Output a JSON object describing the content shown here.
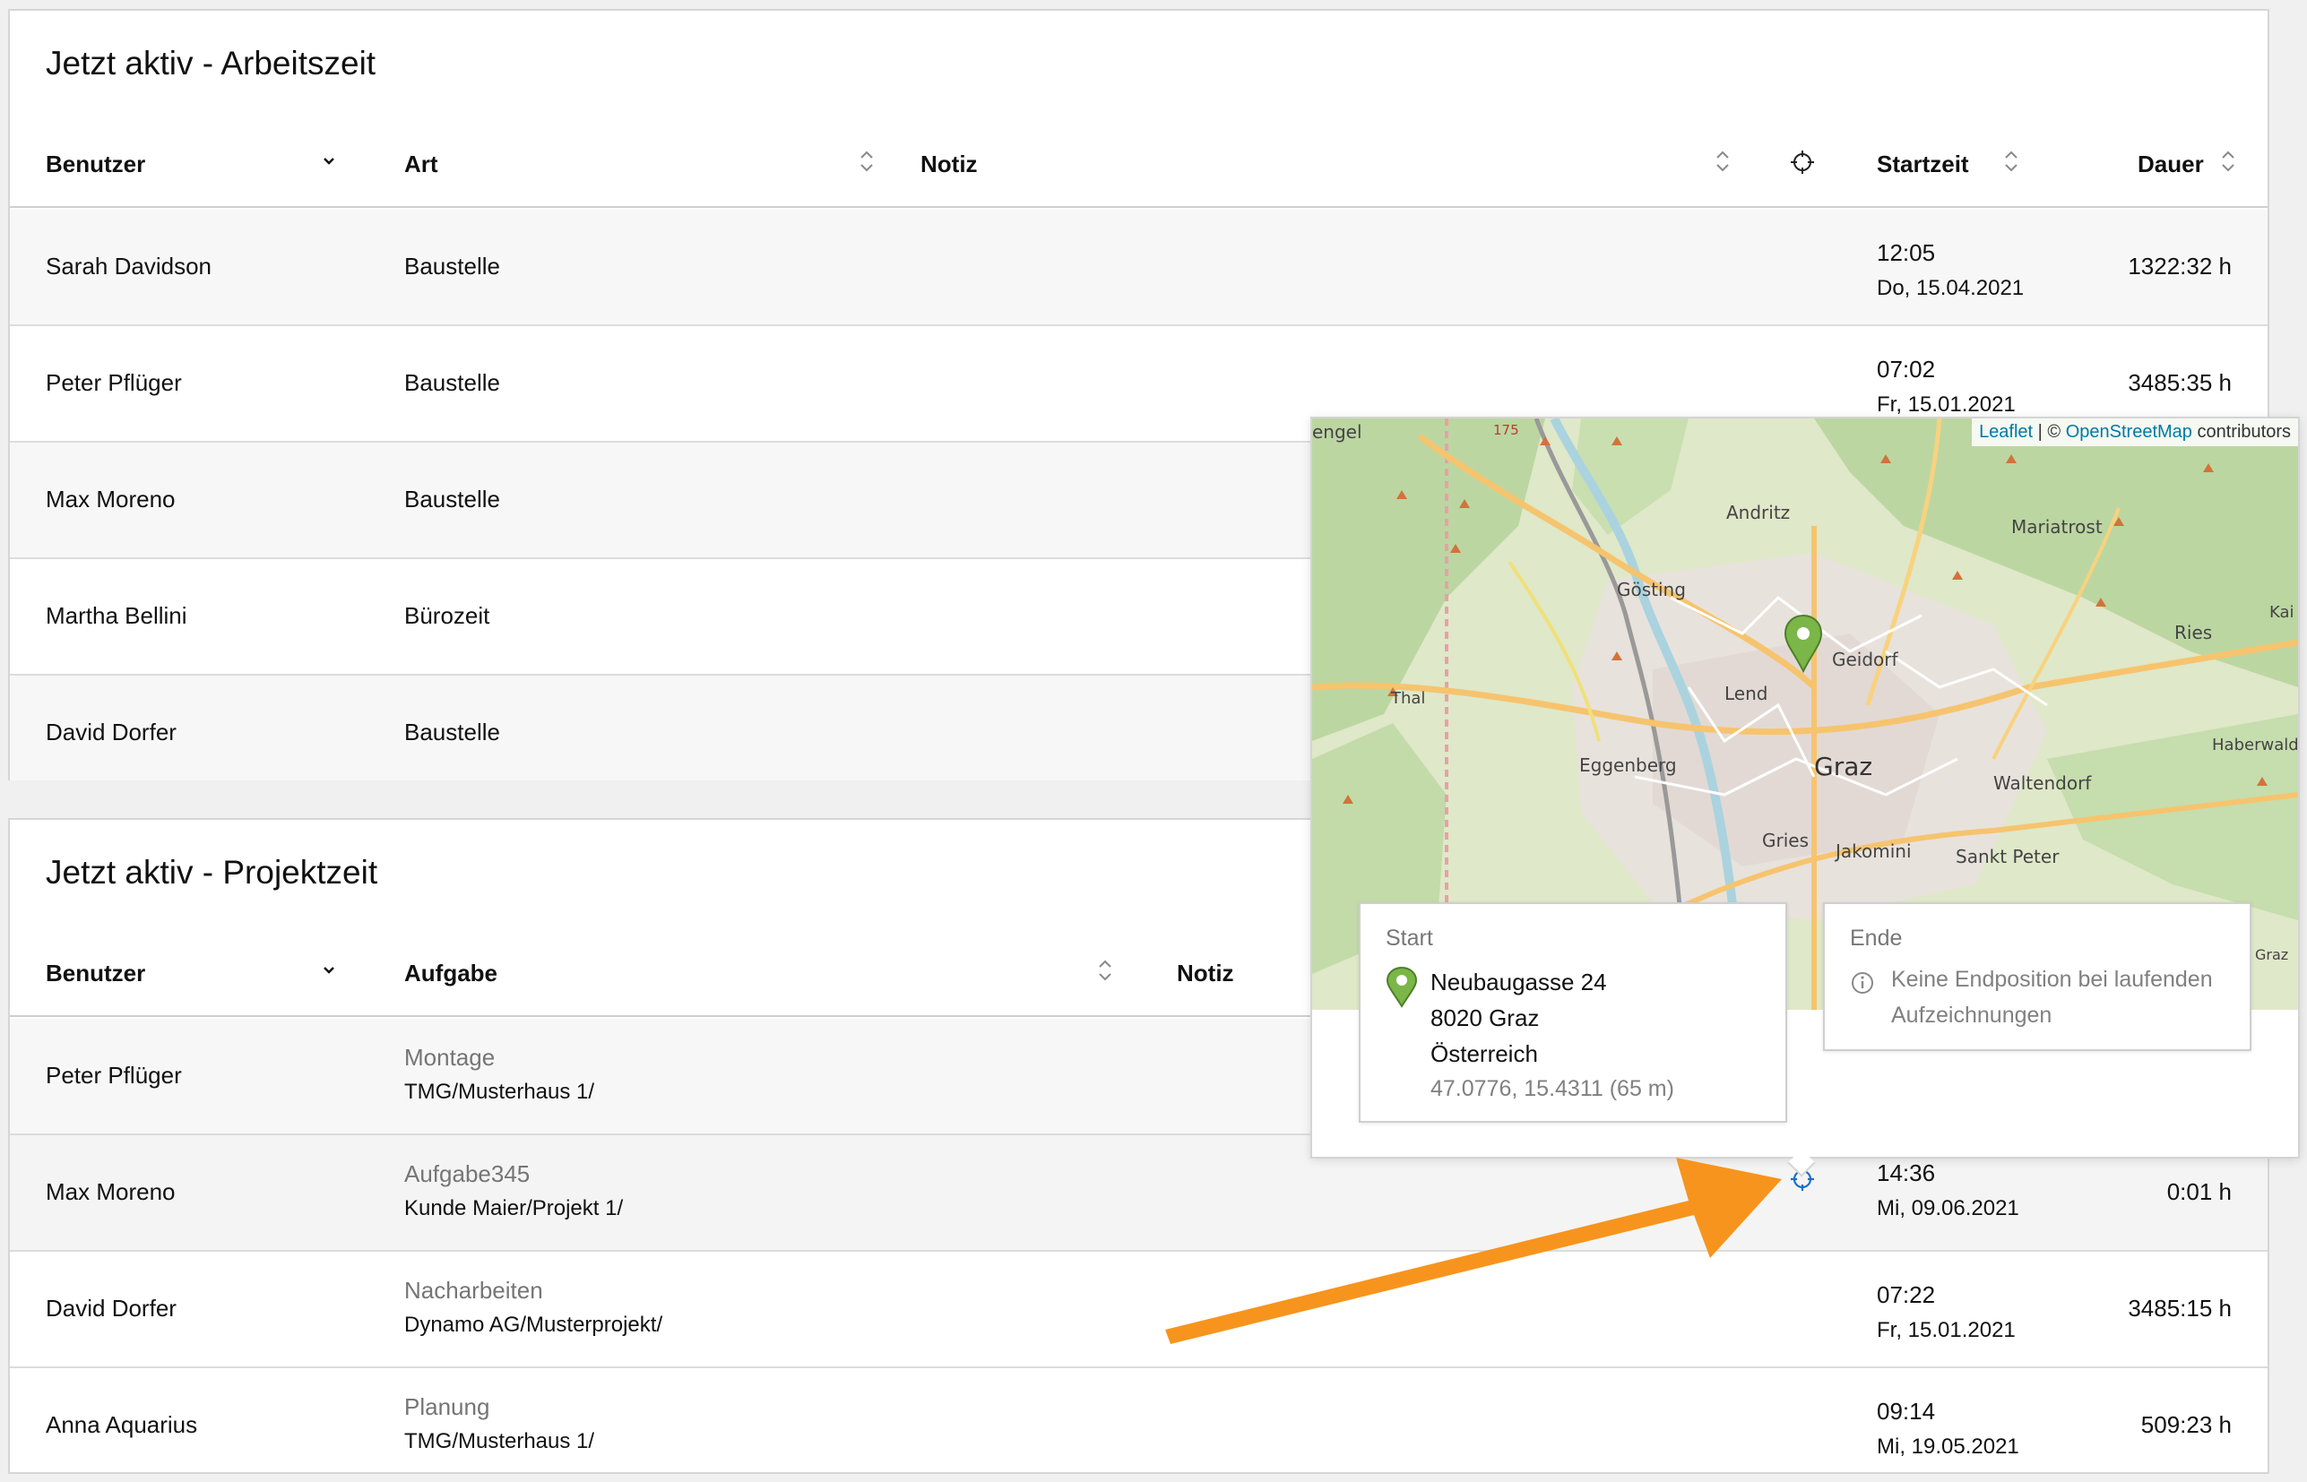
{
  "work_section": {
    "title": "Jetzt aktiv - Arbeitszeit",
    "columns": {
      "user": "Benutzer",
      "type": "Art",
      "note": "Notiz",
      "start": "Startzeit",
      "duration": "Dauer"
    },
    "rows": [
      {
        "user": "Sarah Davidson",
        "type": "Baustelle",
        "time": "12:05",
        "date": "Do, 15.04.2021",
        "duration": "1322:32 h"
      },
      {
        "user": "Peter Pflüger",
        "type": "Baustelle",
        "time": "07:02",
        "date": "Fr, 15.01.2021",
        "duration": "3485:35 h"
      },
      {
        "user": "Max Moreno",
        "type": "Baustelle"
      },
      {
        "user": "Martha Bellini",
        "type": "Bürozeit"
      },
      {
        "user": "David Dorfer",
        "type": "Baustelle"
      }
    ]
  },
  "project_section": {
    "title": "Jetzt aktiv - Projektzeit",
    "columns": {
      "user": "Benutzer",
      "task": "Aufgabe",
      "note": "Notiz"
    },
    "rows": [
      {
        "user": "Peter Pflüger",
        "task": "Montage",
        "path": "TMG/Musterhaus 1/"
      },
      {
        "user": "Max Moreno",
        "task": "Aufgabe345",
        "path": "Kunde Maier/Projekt 1/",
        "time": "14:36",
        "date": "Mi, 09.06.2021",
        "duration": "0:01 h"
      },
      {
        "user": "David Dorfer",
        "task": "Nacharbeiten",
        "path": "Dynamo AG/Musterprojekt/",
        "time": "07:22",
        "date": "Fr, 15.01.2021",
        "duration": "3485:15 h"
      },
      {
        "user": "Anna Aquarius",
        "task": "Planung",
        "path": "TMG/Musterhaus 1/",
        "time": "09:14",
        "date": "Mi, 19.05.2021",
        "duration": "509:23 h"
      }
    ]
  },
  "popup": {
    "attribution": {
      "leaflet": "Leaflet",
      "sep": " | © ",
      "osm": "OpenStreetMap",
      "suffix": " contributors"
    },
    "map_labels": {
      "engel": "engel",
      "andritz": "Andritz",
      "mariatrost": "Mariatrost",
      "kai": "Kai",
      "goesting": "Gösting",
      "ries": "Ries",
      "geidorf": "Geidorf",
      "lend": "Lend",
      "thal": "Thal",
      "haberwald": "Haberwald",
      "eggenberg": "Eggenberg",
      "graz": "Graz",
      "waltendorf": "Waltendorf",
      "gries": "Gries",
      "jakomini": "Jakomini",
      "sankt_peter": "Sankt Peter",
      "graz2": "Graz",
      "road": "175"
    },
    "start": {
      "label": "Start",
      "street": "Neubaugasse 24",
      "city": "8020 Graz",
      "country": "Österreich",
      "coords": "47.0776, 15.4311 (65 m)"
    },
    "end": {
      "label": "Ende",
      "message": "Keine Endposition bei laufenden Aufzeichnungen"
    }
  },
  "colors": {
    "accent_blue": "#1a6fc2",
    "marker_green": "#7ab648",
    "arrow_orange": "#f7941d"
  }
}
